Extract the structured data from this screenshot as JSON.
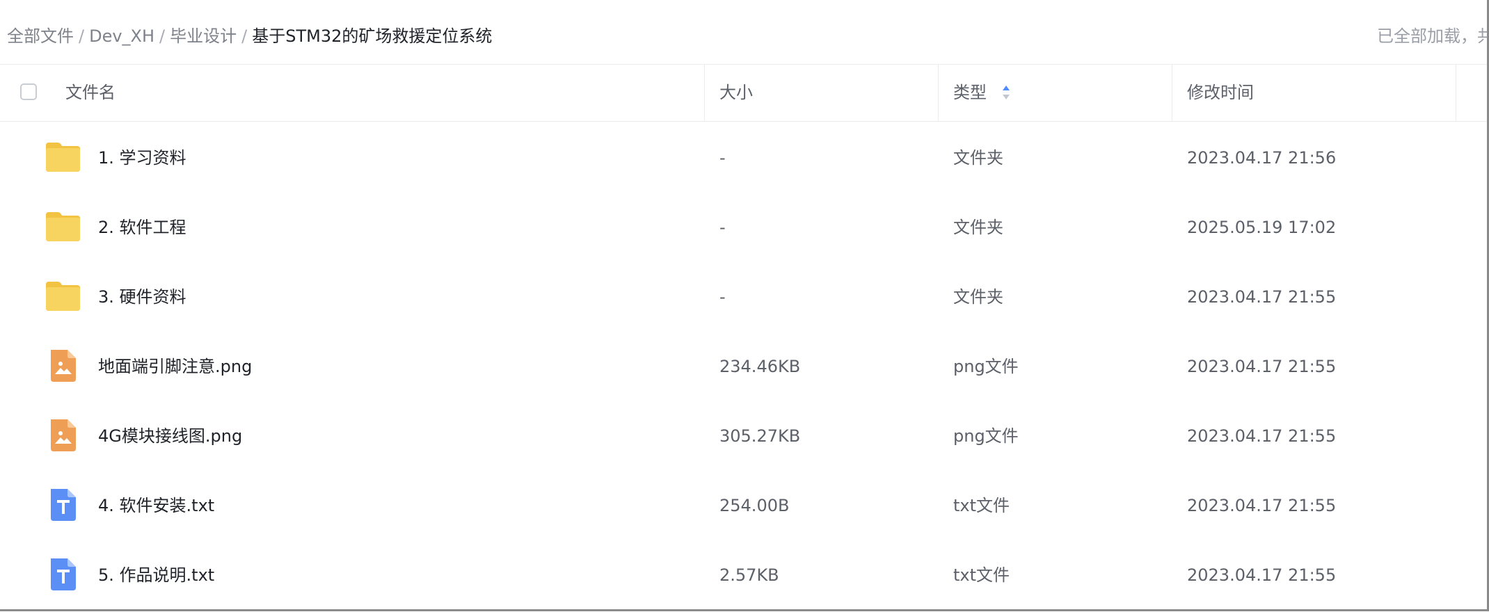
{
  "breadcrumb": {
    "items": [
      "全部文件",
      "Dev_XH",
      "毕业设计"
    ],
    "separator": "/",
    "current": "基于STM32的矿场救援定位系统"
  },
  "status_text": "已全部加载，共",
  "columns": {
    "name": "文件名",
    "size": "大小",
    "type": "类型",
    "modified": "修改时间"
  },
  "sort": {
    "column": "type",
    "direction": "ascending",
    "active_color": "#4e8cff",
    "inactive_color": "#c3c7cf"
  },
  "files": [
    {
      "name": "1. 学习资料",
      "size": "-",
      "type": "文件夹",
      "modified": "2023.04.17 21:56",
      "icon": "folder-icon"
    },
    {
      "name": "2. 软件工程",
      "size": "-",
      "type": "文件夹",
      "modified": "2025.05.19 17:02",
      "icon": "folder-icon"
    },
    {
      "name": "3. 硬件资料",
      "size": "-",
      "type": "文件夹",
      "modified": "2023.04.17 21:55",
      "icon": "folder-icon"
    },
    {
      "name": "地面端引脚注意.png",
      "size": "234.46KB",
      "type": "png文件",
      "modified": "2023.04.17 21:55",
      "icon": "image-file-icon"
    },
    {
      "name": "4G模块接线图.png",
      "size": "305.27KB",
      "type": "png文件",
      "modified": "2023.04.17 21:55",
      "icon": "image-file-icon"
    },
    {
      "name": "4. 软件安装.txt",
      "size": "254.00B",
      "type": "txt文件",
      "modified": "2023.04.17 21:55",
      "icon": "text-file-icon"
    },
    {
      "name": "5. 作品说明.txt",
      "size": "2.57KB",
      "type": "txt文件",
      "modified": "2023.04.17 21:55",
      "icon": "text-file-icon"
    }
  ],
  "colors": {
    "folder": "#f7d35f",
    "image_file": "#ef9f55",
    "text_file": "#5b8ff6"
  }
}
